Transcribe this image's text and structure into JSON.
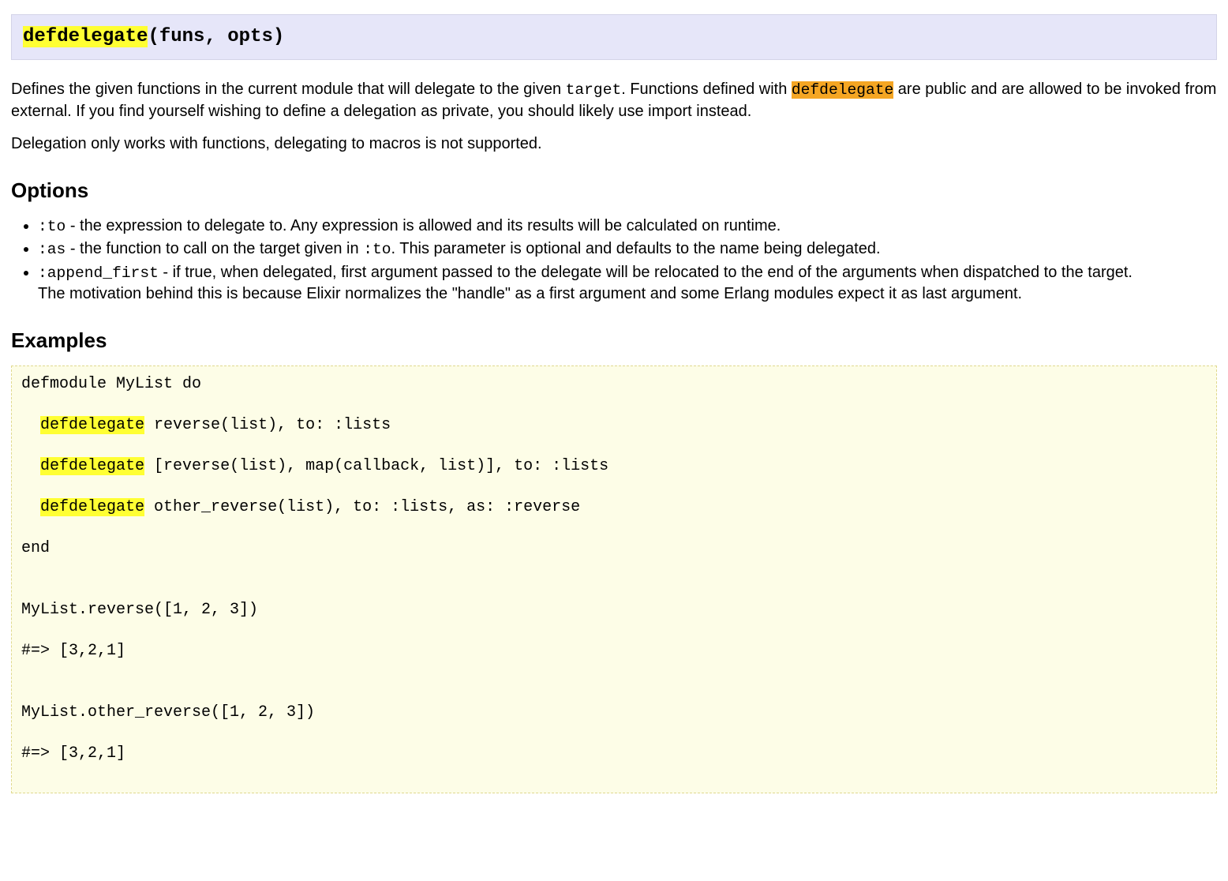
{
  "signature": {
    "macro_name": "defdelegate",
    "args": "(funs, opts)"
  },
  "description": {
    "p1_before_target": "Defines the given functions in the current module that will delegate to the given ",
    "target_code": "target",
    "p1_after_target": ". Functions defined with ",
    "defdelegate_code": "defdelegate",
    "p1_after_def": " are public and are allowed to be invoked from external. If you find yourself wishing to define a delegation as private, you should likely use import instead.",
    "p2": "Delegation only works with functions, delegating to macros is not supported."
  },
  "options_heading": "Options",
  "options": {
    "to": {
      "name": ":to",
      "desc": " - the expression to delegate to. Any expression is allowed and its results will be calculated on runtime."
    },
    "as": {
      "name": ":as",
      "pre": " - the function to call on the target given in ",
      "to_code": ":to",
      "post": ". This parameter is optional and defaults to the name being delegated."
    },
    "append": {
      "name": ":append_first",
      "desc1": " - if true, when delegated, first argument passed to the delegate will be relocated to the end of the arguments when dispatched to the target.",
      "desc2": "The motivation behind this is because Elixir normalizes the \"handle\" as a first argument and some Erlang modules expect it as last argument."
    }
  },
  "examples_heading": "Examples",
  "code": {
    "kw": "defdelegate",
    "l1": "defmodule MyList do",
    "l2_pre": "  ",
    "l2_post": " reverse(list), to: :lists",
    "l3_pre": "  ",
    "l3_post": " [reverse(list), map(callback, list)], to: :lists",
    "l4_pre": "  ",
    "l4_post": " other_reverse(list), to: :lists, as: :reverse",
    "l5": "end",
    "l6": "",
    "l7": "MyList.reverse([1, 2, 3])",
    "l8": "#=> [3,2,1]",
    "l9": "",
    "l10": "MyList.other_reverse([1, 2, 3])",
    "l11": "#=> [3,2,1]"
  }
}
